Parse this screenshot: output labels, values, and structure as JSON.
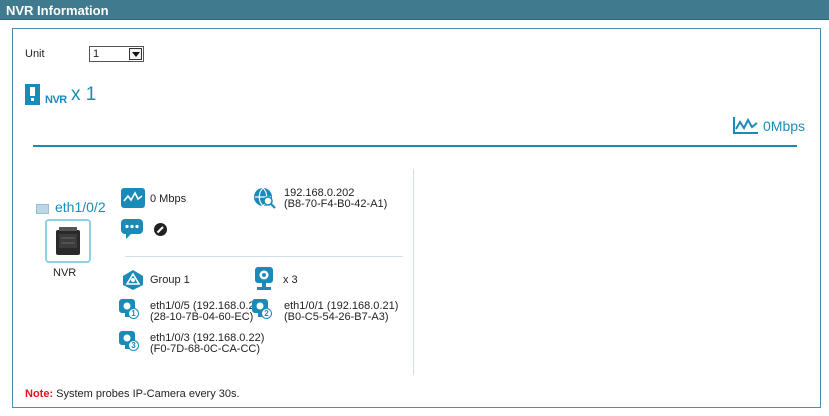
{
  "window": {
    "title": "NVR Information"
  },
  "unit": {
    "label": "Unit",
    "selected": "1"
  },
  "summary": {
    "device_label": "NVR",
    "count_text": "x 1",
    "bandwidth_text": "0Mbps"
  },
  "device": {
    "port": "eth1/0/2",
    "name": "NVR",
    "bandwidth": "0 Mbps",
    "ip": "192.168.0.202",
    "mac": "(B8-70-F4-B0-42-A1)",
    "group": "Group 1",
    "camera_count": "x 3"
  },
  "cameras": [
    {
      "number": "1",
      "line1": "eth1/0/5 (192.168.0.23)",
      "line2": "(28-10-7B-04-60-EC)"
    },
    {
      "number": "2",
      "line1": "eth1/0/1 (192.168.0.21)",
      "line2": "(B0-C5-54-26-B7-A3)"
    },
    {
      "number": "3",
      "line1": "eth1/0/3 (192.168.0.22)",
      "line2": "(F0-7D-68-0C-CA-CC)"
    }
  ],
  "note": {
    "prefix": "Note:",
    "text": " System probes IP-Camera every 30s."
  },
  "colors": {
    "accent": "#1a8bb8",
    "titlebar": "#3f7a8e",
    "note": "#e3151a"
  }
}
